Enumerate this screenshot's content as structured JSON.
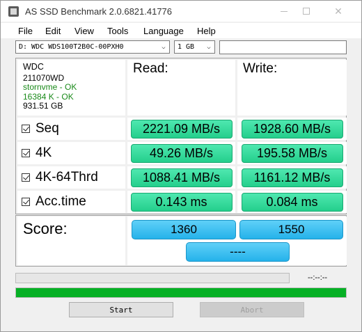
{
  "window": {
    "title": "AS SSD Benchmark 2.0.6821.41776",
    "minimize": "—",
    "maximize": "☐",
    "close": "✕"
  },
  "menu": [
    "File",
    "Edit",
    "View",
    "Tools",
    "Language",
    "Help"
  ],
  "selectors": {
    "drive": "D: WDC WDS100T2B0C-00PXH0",
    "size": "1 GB",
    "extra": ""
  },
  "drive_info": {
    "vendor": "WDC",
    "firmware": "211070WD",
    "driver": "stornvme - OK",
    "alignment": "16384 K - OK",
    "capacity": "931.51 GB"
  },
  "headers": {
    "read": "Read:",
    "write": "Write:"
  },
  "tests": [
    {
      "label": "Seq",
      "checked": true,
      "read": "2221.09 MB/s",
      "write": "1928.60 MB/s"
    },
    {
      "label": "4K",
      "checked": true,
      "read": "49.26 MB/s",
      "write": "195.58 MB/s"
    },
    {
      "label": "4K-64Thrd",
      "checked": true,
      "read": "1088.41 MB/s",
      "write": "1161.12 MB/s"
    },
    {
      "label": "Acc.time",
      "checked": true,
      "read": "0.143 ms",
      "write": "0.084 ms"
    }
  ],
  "score": {
    "label": "Score:",
    "read": "1360",
    "write": "1550",
    "total": "----"
  },
  "progress": {
    "time": "--:--:--",
    "top_fraction": 0,
    "main_fraction": 1.0
  },
  "buttons": {
    "start": "Start",
    "abort": "Abort"
  },
  "colors": {
    "result_green": "#24cf8c",
    "score_blue": "#25b2ea",
    "progress_green": "#06b025"
  }
}
